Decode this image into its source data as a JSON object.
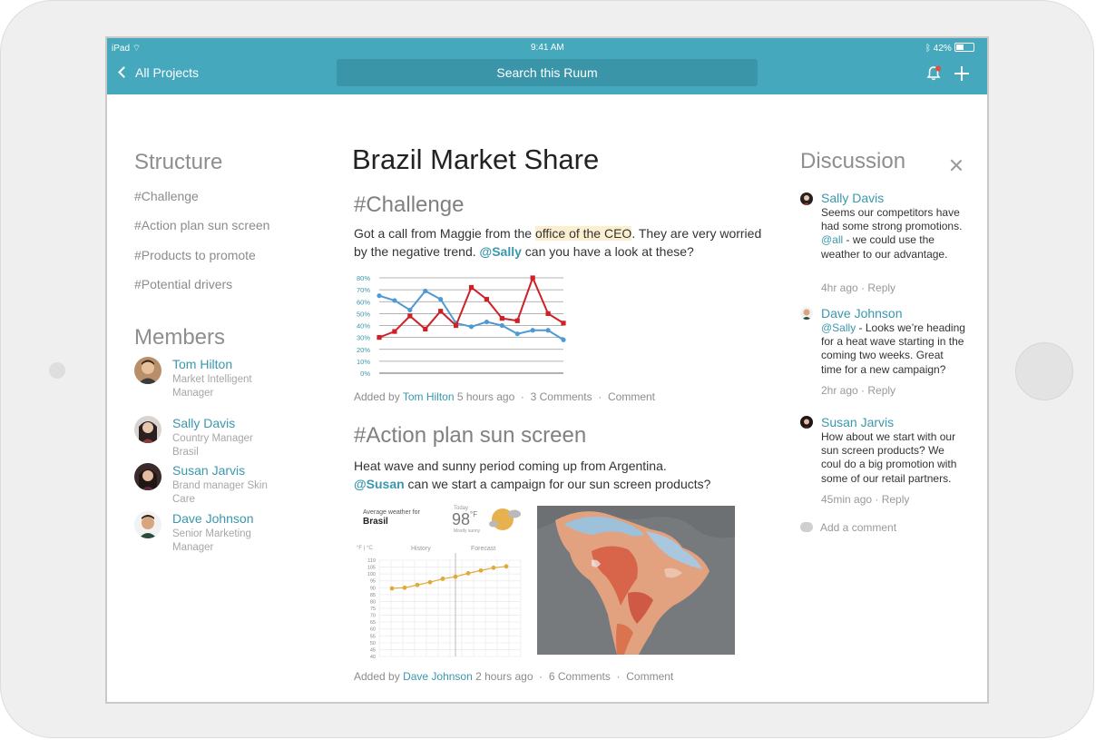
{
  "status_bar": {
    "device": "iPad",
    "time": "9:41 AM",
    "battery": "42%"
  },
  "nav": {
    "back_label": "All Projects",
    "search_placeholder": "Search this Ruum"
  },
  "structure": {
    "heading": "Structure",
    "items": [
      "#Challenge",
      "#Action plan sun screen",
      "#Products to promote",
      "#Potential drivers"
    ]
  },
  "members": {
    "heading": "Members",
    "list": [
      {
        "name": "Tom Hilton",
        "role": "Market Intelligent Manager"
      },
      {
        "name": "Sally Davis",
        "role": "Country Manager Brasil"
      },
      {
        "name": "Susan Jarvis",
        "role": "Brand manager Skin Care"
      },
      {
        "name": "Dave Johnson",
        "role": "Senior Marketing Manager"
      }
    ]
  },
  "main": {
    "title": "Brazil Market Share",
    "sections": [
      {
        "heading": "#Challenge",
        "text_before_highlight": "Got a call from Maggie from the ",
        "highlight": "office of the CEO",
        "text_after_highlight": ". They are very worried by the negative trend. ",
        "mention": "@Sally",
        "text_end": " can you have a look at these?",
        "added_by_prefix": "Added by",
        "author": "Tom Hilton",
        "time": "5 hours ago",
        "comments": "3 Comments",
        "comment_action": "Comment"
      },
      {
        "heading": "#Action plan sun screen",
        "text_line1": "Heat wave and sunny period coming up from Argentina.",
        "mention": "@Susan",
        "text_line2": " can we start a campaign for our sun screen products?",
        "added_by_prefix": "Added by",
        "author": "Dave Johnson",
        "time": "2 hours ago",
        "comments": "6 Comments",
        "comment_action": "Comment"
      }
    ],
    "weather_widget": {
      "caption": "Average weather for",
      "place": "Brasil",
      "today_label": "Today",
      "temperature": "98",
      "unit": "°F",
      "condition": "Mostly sunny",
      "units_toggle": "°F | °C",
      "history_label": "History",
      "forecast_label": "Forecast",
      "y_ticks": [
        "110",
        "105",
        "100",
        "95",
        "90",
        "85",
        "80",
        "75",
        "70",
        "65",
        "60",
        "55",
        "50",
        "45",
        "40"
      ],
      "points": [
        89.5,
        90,
        92,
        94,
        96.5,
        98,
        100.5,
        102.5,
        104.5,
        105.5
      ]
    }
  },
  "chart_data": {
    "type": "line",
    "x": [
      1,
      2,
      3,
      4,
      5,
      6,
      7,
      8,
      9,
      10,
      11,
      12,
      13
    ],
    "y_ticks": [
      "0%",
      "10%",
      "20%",
      "30%",
      "40%",
      "50%",
      "60%",
      "70%",
      "80%"
    ],
    "ylim": [
      0,
      80
    ],
    "grid": true,
    "series": [
      {
        "color": "#4e9ad4",
        "values": [
          65,
          61,
          53,
          69,
          62,
          42,
          39,
          43,
          40,
          33,
          36,
          36,
          28
        ]
      },
      {
        "color": "#cf2027",
        "values": [
          30,
          35,
          48,
          37,
          52,
          40,
          72,
          62,
          46,
          44,
          80,
          50,
          42
        ]
      }
    ]
  },
  "discussion": {
    "heading": "Discussion",
    "comments": [
      {
        "name": "Sally Davis",
        "text": "Seems our competitors have had some strong promotions.",
        "mention": "@all",
        "text2": " - we could use the weather to our advantage.",
        "meta": "4hr ago · Reply"
      },
      {
        "name": "Dave Johnson",
        "mention": "@Sally",
        "text": " - Looks we’re heading for a heat wave starting in the coming two weeks. Great time for a new campaign?",
        "meta": "2hr ago · Reply"
      },
      {
        "name": "Susan Jarvis",
        "text": "How about we start with our sun screen products? We coul do a big promotion with some of our retail partners.",
        "meta": "45min ago · Reply"
      }
    ],
    "add_comment": "Add a comment"
  },
  "colors": {
    "accent": "#45a8bd",
    "link": "#3b97ad",
    "highlight": "#fcefcf"
  }
}
